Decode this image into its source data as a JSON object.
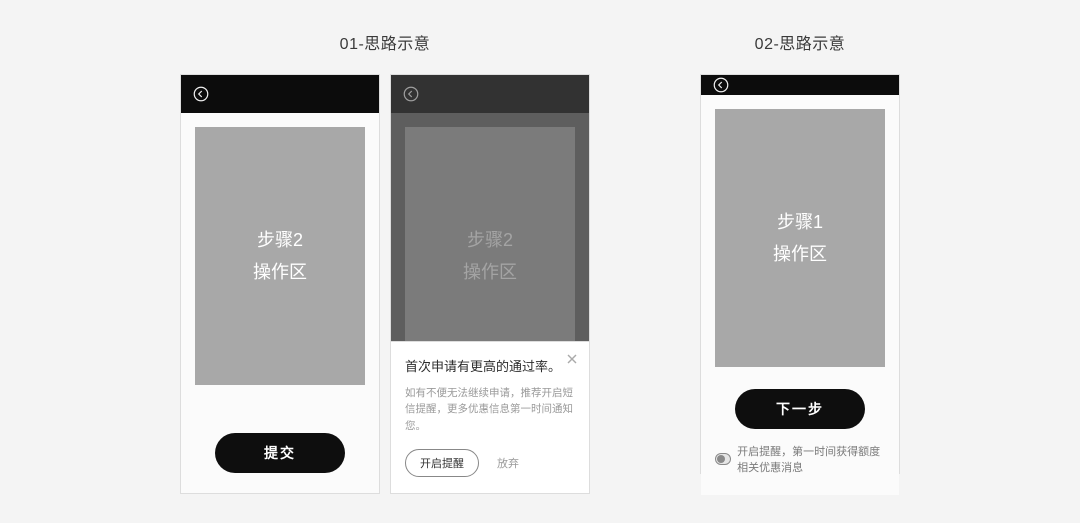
{
  "group1": {
    "title": "01-思路示意",
    "screenA": {
      "step_line1": "步骤2",
      "step_line2": "操作区",
      "primary_btn": "提交"
    },
    "screenB": {
      "step_line1": "步骤2",
      "step_line2": "操作区",
      "popup": {
        "title": "首次申请有更高的通过率。",
        "desc": "如有不便无法继续申请，推荐开启短信提醒，更多优惠信息第一时间通知您。",
        "enable_btn": "开启提醒",
        "dismiss_btn": "放弃"
      }
    }
  },
  "group2": {
    "title": "02-思路示意",
    "screenA": {
      "step_line1": "步骤1",
      "step_line2": "操作区",
      "primary_btn": "下一步",
      "toggle_label": "开启提醒，第一时间获得额度相关优惠消息"
    }
  }
}
